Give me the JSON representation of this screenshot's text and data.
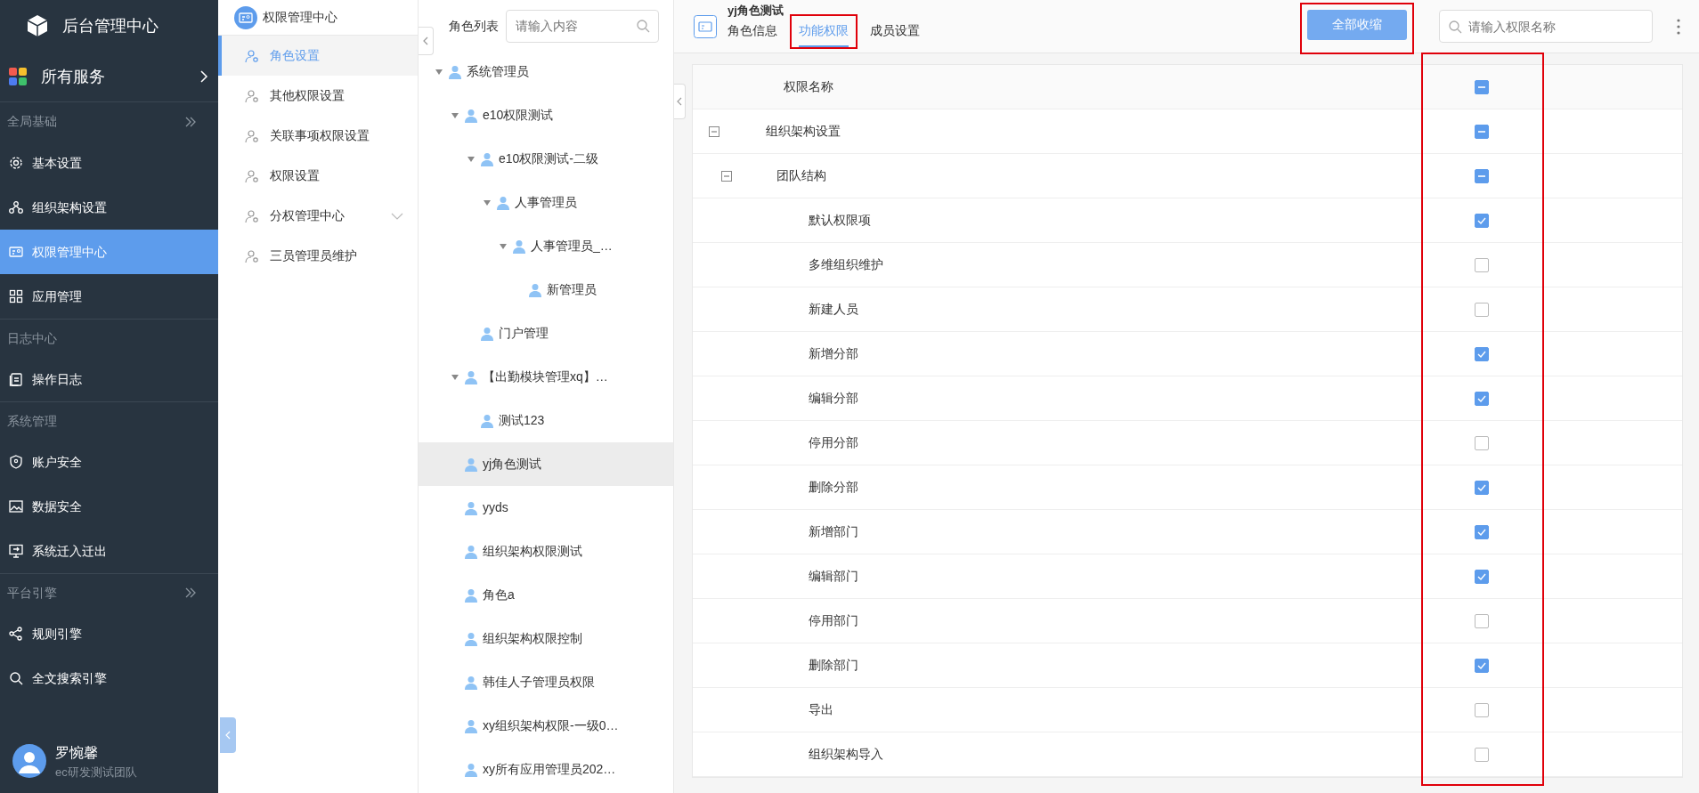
{
  "app": {
    "title": "后台管理中心"
  },
  "all_services": {
    "label": "所有服务"
  },
  "nav": [
    {
      "kind": "section",
      "label": "全局基础",
      "collapsible": true
    },
    {
      "kind": "item",
      "label": "基本设置",
      "selected": false
    },
    {
      "kind": "item",
      "label": "组织架构设置",
      "selected": false
    },
    {
      "kind": "item",
      "label": "权限管理中心",
      "selected": true
    },
    {
      "kind": "item",
      "label": "应用管理",
      "selected": false
    },
    {
      "kind": "section",
      "label": "日志中心",
      "collapsible": false
    },
    {
      "kind": "item",
      "label": "操作日志",
      "selected": false
    },
    {
      "kind": "section",
      "label": "系统管理",
      "collapsible": false
    },
    {
      "kind": "item",
      "label": "账户安全",
      "selected": false
    },
    {
      "kind": "item",
      "label": "数据安全",
      "selected": false
    },
    {
      "kind": "item",
      "label": "系统迁入迁出",
      "selected": false
    },
    {
      "kind": "section",
      "label": "平台引擎",
      "collapsible": true
    },
    {
      "kind": "item",
      "label": "规则引擎",
      "selected": false
    },
    {
      "kind": "item",
      "label": "全文搜索引擎",
      "selected": false
    }
  ],
  "user": {
    "name": "罗惋馨",
    "team": "ec研发测试团队"
  },
  "submenu": {
    "title": "权限管理中心",
    "items": [
      {
        "label": "角色设置",
        "selected": true,
        "has_children": false
      },
      {
        "label": "其他权限设置",
        "selected": false,
        "has_children": false
      },
      {
        "label": "关联事项权限设置",
        "selected": false,
        "has_children": false
      },
      {
        "label": "权限设置",
        "selected": false,
        "has_children": false
      },
      {
        "label": "分权管理中心",
        "selected": false,
        "has_children": true
      },
      {
        "label": "三员管理员维护",
        "selected": false,
        "has_children": false
      }
    ]
  },
  "role_list": {
    "title": "角色列表",
    "search": {
      "placeholder": "请输入内容"
    },
    "tree": [
      {
        "label": "系统管理员",
        "selected": false,
        "expanded": true,
        "children": [
          {
            "label": "e10权限测试",
            "selected": false,
            "expanded": true,
            "children": [
              {
                "label": "e10权限测试-二级",
                "selected": false,
                "expanded": true,
                "children": [
                  {
                    "label": "人事管理员",
                    "selected": false,
                    "expanded": true,
                    "children": [
                      {
                        "label": "人事管理员_…",
                        "selected": false,
                        "expanded": true,
                        "children": [
                          {
                            "label": "新管理员",
                            "selected": false
                          }
                        ]
                      }
                    ]
                  }
                ]
              },
              {
                "label": "门户管理",
                "selected": false
              }
            ]
          },
          {
            "label": "【出勤模块管理xq】…",
            "selected": false,
            "expanded": true,
            "children": [
              {
                "label": "测试123",
                "selected": false
              }
            ]
          },
          {
            "label": "yj角色测试",
            "selected": true
          },
          {
            "label": "yyds",
            "selected": false
          },
          {
            "label": "组织架构权限测试",
            "selected": false
          },
          {
            "label": "角色a",
            "selected": false
          },
          {
            "label": "组织架构权限控制",
            "selected": false
          },
          {
            "label": "韩佳人子管理员权限",
            "selected": false
          },
          {
            "label": "xy组织架构权限-一级0…",
            "selected": false
          },
          {
            "label": "xy所有应用管理员202…",
            "selected": false
          }
        ]
      }
    ]
  },
  "detail": {
    "title": "yj角色测试",
    "tabs": [
      {
        "label": "角色信息",
        "selected": false,
        "highlighted": false
      },
      {
        "label": "功能权限",
        "selected": true,
        "highlighted": true
      },
      {
        "label": "成员设置",
        "selected": false,
        "highlighted": false
      }
    ],
    "collapse_button": {
      "label": "全部收缩",
      "highlighted": true
    },
    "search": {
      "placeholder": "请输入权限名称"
    },
    "table": {
      "column": "权限名称",
      "indeterminate": true,
      "check_column_highlighted": true,
      "rows": [
        {
          "label": "组织架构设置",
          "indeterminate": true,
          "expanded": true,
          "children": [
            {
              "label": "团队结构",
              "indeterminate": true,
              "expanded": true,
              "children": [
                {
                  "label": "默认权限项",
                  "checked": true,
                  "indeterminate": false
                },
                {
                  "label": "多维组织维护",
                  "checked": false,
                  "indeterminate": false
                },
                {
                  "label": "新建人员",
                  "checked": false,
                  "indeterminate": false
                },
                {
                  "label": "新增分部",
                  "checked": true,
                  "indeterminate": false
                },
                {
                  "label": "编辑分部",
                  "checked": true,
                  "indeterminate": false
                },
                {
                  "label": "停用分部",
                  "checked": false,
                  "indeterminate": false
                },
                {
                  "label": "删除分部",
                  "checked": true,
                  "indeterminate": false
                },
                {
                  "label": "新增部门",
                  "checked": true,
                  "indeterminate": false
                },
                {
                  "label": "编辑部门",
                  "checked": true,
                  "indeterminate": false
                },
                {
                  "label": "停用部门",
                  "checked": false,
                  "indeterminate": false
                },
                {
                  "label": "删除部门",
                  "checked": true,
                  "indeterminate": false
                },
                {
                  "label": "导出",
                  "checked": false,
                  "indeterminate": false
                },
                {
                  "label": "组织架构导入",
                  "checked": false,
                  "indeterminate": false
                }
              ]
            }
          ]
        }
      ]
    }
  }
}
